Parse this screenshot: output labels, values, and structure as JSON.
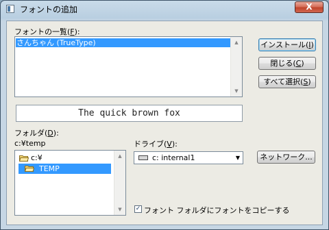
{
  "window": {
    "title": "フォントの追加",
    "close_glyph": "X"
  },
  "font_list": {
    "label_prefix": "フォントの一覧(",
    "label_key": "F",
    "label_suffix": "):",
    "items": [
      "さんちゃん (TrueType)"
    ]
  },
  "buttons": {
    "install": {
      "prefix": "インストール(",
      "key": "I",
      "suffix": ")"
    },
    "close": {
      "prefix": "閉じる(",
      "key": "C",
      "suffix": ")"
    },
    "select_all": {
      "prefix": "すべて選択(",
      "key": "S",
      "suffix": ")"
    },
    "network": {
      "label": "ネットワーク..."
    }
  },
  "preview": {
    "text": "The quick brown fox"
  },
  "folder": {
    "label_prefix": "フォルダ(",
    "label_key": "D",
    "label_suffix": "):",
    "current_path": "c:¥temp",
    "tree": [
      {
        "name": "c:¥",
        "selected": false
      },
      {
        "name": "TEMP",
        "selected": true
      }
    ]
  },
  "drive": {
    "label_prefix": "ドライブ(",
    "label_key": "V",
    "label_suffix": "):",
    "selected": "c: internal1"
  },
  "copy_option": {
    "label": "フォント フォルダにフォントをコピーする",
    "checked": true,
    "check_glyph": "✓"
  },
  "colors": {
    "selection": "#3399ff",
    "close_button": "#c1452c"
  }
}
